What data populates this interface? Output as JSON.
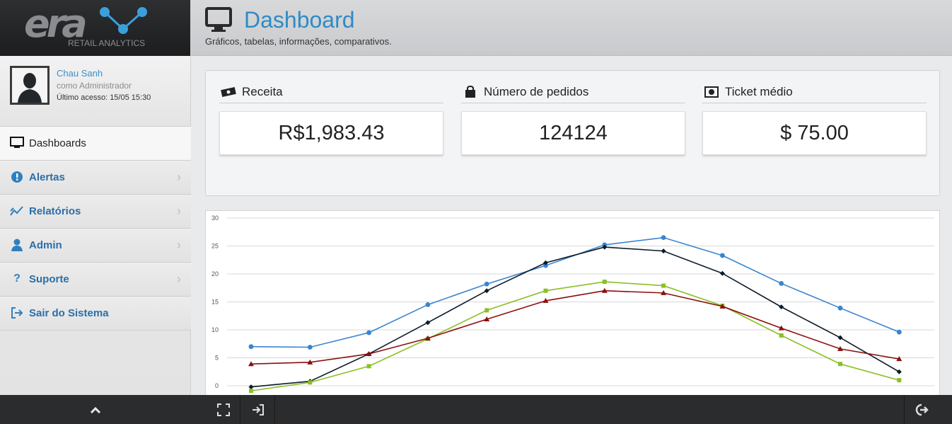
{
  "brand": {
    "logo_text": "era",
    "tagline": "RETAIL ANALYTICS"
  },
  "user": {
    "name": "Chau Sanh",
    "role": "como Administrador",
    "last_access": "Último acesso: 15/05 15:30"
  },
  "nav": {
    "items": [
      {
        "label": "Dashboards",
        "icon": "monitor-icon",
        "active": true
      },
      {
        "label": "Alertas",
        "icon": "alert-icon"
      },
      {
        "label": "Relatórios",
        "icon": "chart-line-icon"
      },
      {
        "label": "Admin",
        "icon": "user-icon"
      },
      {
        "label": "Suporte",
        "icon": "question-icon"
      },
      {
        "label": "Sair do Sistema",
        "icon": "sign-out-icon"
      }
    ]
  },
  "header": {
    "title": "Dashboard",
    "subtitle": "Gráficos, tabelas, informações, comparativos."
  },
  "stats": [
    {
      "title": "Receita",
      "value": "R$1,983.43",
      "icon": "money-icon"
    },
    {
      "title": "Número de pedidos",
      "value": "124124",
      "icon": "bag-icon"
    },
    {
      "title": "Ticket médio",
      "value": "$ 75.00",
      "icon": "cash-icon"
    }
  ],
  "colors": {
    "accent": "#2f8bc5",
    "series_blue": "#3a84cf",
    "series_black": "#0d1b2a",
    "series_green": "#8cbf26",
    "series_red": "#8b0f0f"
  },
  "chart_data": {
    "type": "line",
    "ylim": [
      0,
      30
    ],
    "yticks": [
      0,
      5,
      10,
      15,
      20,
      25,
      30
    ],
    "grid": true,
    "x": [
      1,
      2,
      3,
      4,
      5,
      6,
      7,
      8,
      9,
      10,
      11,
      12
    ],
    "series": [
      {
        "values": [
          7.0,
          6.9,
          9.5,
          14.5,
          18.2,
          21.5,
          25.2,
          26.5,
          23.3,
          18.3,
          13.9,
          9.6
        ],
        "color": "#3a84cf",
        "marker": "circle"
      },
      {
        "values": [
          -0.2,
          0.8,
          5.7,
          11.3,
          17.0,
          22.0,
          24.8,
          24.1,
          20.1,
          14.1,
          8.6,
          2.5
        ],
        "color": "#0d1b2a",
        "marker": "diamond"
      },
      {
        "values": [
          -0.9,
          0.6,
          3.5,
          8.4,
          13.5,
          17.0,
          18.6,
          17.9,
          14.3,
          9.0,
          3.9,
          1.0
        ],
        "color": "#8cbf26",
        "marker": "square"
      },
      {
        "values": [
          3.9,
          4.2,
          5.7,
          8.5,
          11.9,
          15.2,
          17.0,
          16.6,
          14.2,
          10.3,
          6.6,
          4.8
        ],
        "color": "#8b0f0f",
        "marker": "triangle"
      }
    ]
  }
}
